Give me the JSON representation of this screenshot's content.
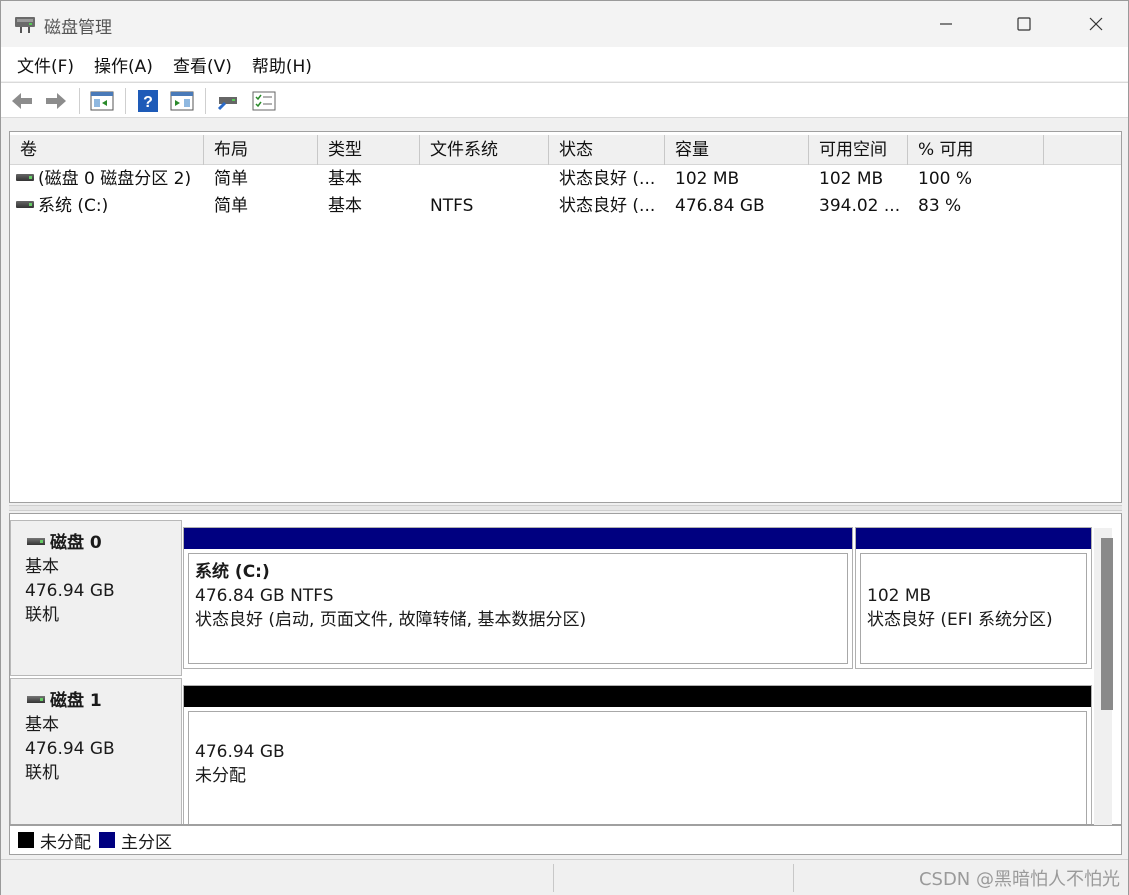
{
  "window": {
    "title": "磁盘管理",
    "icon": "disk-management-icon"
  },
  "menu": [
    "文件(F)",
    "操作(A)",
    "查看(V)",
    "帮助(H)"
  ],
  "toolbar": {
    "buttons": [
      "back-arrow-icon",
      "forward-arrow-icon",
      "console-tree-icon",
      "help-icon",
      "properties-icon",
      "connect-icon",
      "list-icon"
    ]
  },
  "volume_list": {
    "columns": [
      "卷",
      "布局",
      "类型",
      "文件系统",
      "状态",
      "容量",
      "可用空间",
      "% 可用"
    ],
    "rows": [
      {
        "volume": "(磁盘 0 磁盘分区 2)",
        "layout": "简单",
        "type": "基本",
        "fs": "",
        "status": "状态良好 (...",
        "capacity": "102 MB",
        "free": "102 MB",
        "pct": "100 %"
      },
      {
        "volume": "系统 (C:)",
        "layout": "简单",
        "type": "基本",
        "fs": "NTFS",
        "status": "状态良好 (...",
        "capacity": "476.84 GB",
        "free": "394.02 ...",
        "pct": "83 %"
      }
    ]
  },
  "disks": [
    {
      "name": "磁盘 0",
      "type": "基本",
      "size": "476.94 GB",
      "state": "联机",
      "partitions": [
        {
          "title": "系统 (C:)",
          "size_fs": "476.84 GB NTFS",
          "status": "状态良好 (启动, 页面文件, 故障转储, 基本数据分区)",
          "bar_color": "#000080"
        },
        {
          "title": "",
          "size_fs": "102 MB",
          "status": "状态良好 (EFI 系统分区)",
          "bar_color": "#000080"
        }
      ]
    },
    {
      "name": "磁盘 1",
      "type": "基本",
      "size": "476.94 GB",
      "state": "联机",
      "partitions": [
        {
          "size": "476.94 GB",
          "status": "未分配",
          "bar_color": "#000000"
        }
      ]
    }
  ],
  "legend": [
    {
      "label": "未分配",
      "color": "#000000"
    },
    {
      "label": "主分区",
      "color": "#000080"
    }
  ],
  "watermark": "CSDN @黑暗怕人不怕光"
}
